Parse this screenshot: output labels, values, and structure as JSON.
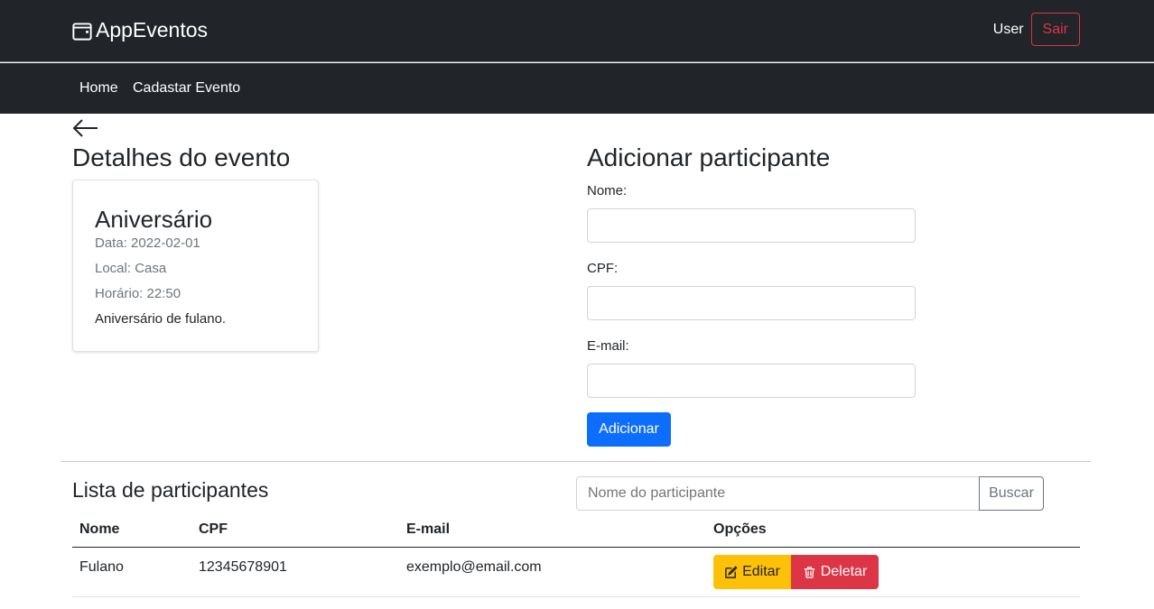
{
  "header": {
    "brand": "AppEventos",
    "brand_icon": "calendar-icon",
    "user": "User",
    "logout": "Sair"
  },
  "nav": {
    "items": [
      {
        "label": "Home"
      },
      {
        "label": "Cadastar Evento"
      }
    ]
  },
  "details": {
    "heading": "Detalhes do evento",
    "event": {
      "title": "Aniversário",
      "date": "Data: 2022-02-01",
      "place": "Local: Casa",
      "time": "Horário: 22:50",
      "description": "Aniversário de fulano."
    }
  },
  "add_form": {
    "heading": "Adicionar participante",
    "name_label": "Nome:",
    "cpf_label": "CPF:",
    "email_label": "E-mail:",
    "name_value": "",
    "cpf_value": "",
    "email_value": "",
    "submit": "Adicionar"
  },
  "list": {
    "heading": "Lista de participantes",
    "search_placeholder": "Nome do participante",
    "search_button": "Buscar",
    "columns": [
      "Nome",
      "CPF",
      "E-mail",
      "Opções"
    ],
    "rows": [
      {
        "name": "Fulano",
        "cpf": "12345678901",
        "email": "exemplo@email.com",
        "edit": "Editar",
        "delete": "Deletar"
      }
    ]
  },
  "colors": {
    "dark": "#212529",
    "primary": "#0d6efd",
    "warning": "#ffc107",
    "danger": "#dc3545"
  }
}
